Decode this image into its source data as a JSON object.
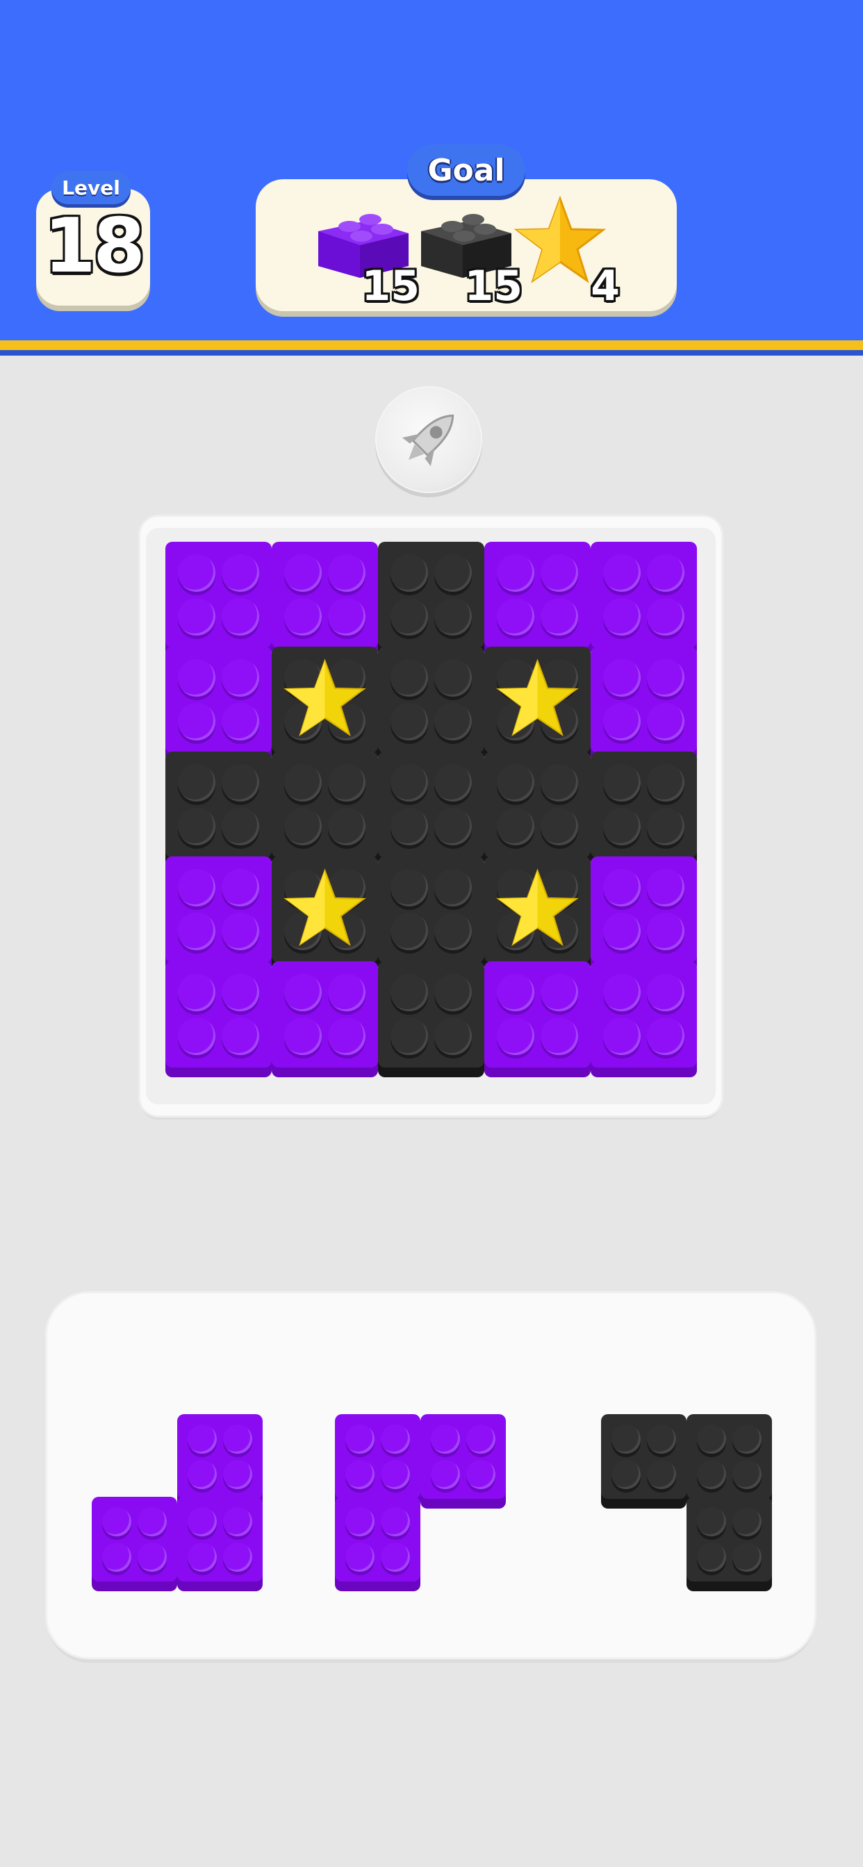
{
  "header": {
    "level_label": "Level",
    "level_number": "18",
    "goal_label": "Goal",
    "goals": [
      {
        "item": "purple-brick-icon",
        "count": "15",
        "color": "#7a12f0"
      },
      {
        "item": "black-brick-icon",
        "count": "15",
        "color": "#2e2e2e"
      },
      {
        "item": "star-icon",
        "count": "4",
        "color": "#f5c01c"
      }
    ]
  },
  "booster": {
    "icon": "rocket-icon"
  },
  "colors": {
    "purple": "#8a0bf2",
    "black": "#2e2e2e",
    "header_blue": "#3d6dfd",
    "accent_yellow": "#f5c01c"
  },
  "board": {
    "rows": 5,
    "cols": 5,
    "cells": [
      [
        "P",
        "P",
        "B",
        "P",
        "P"
      ],
      [
        "P",
        "B*",
        "B",
        "B*",
        "P"
      ],
      [
        "B",
        "B",
        "B",
        "B",
        "B"
      ],
      [
        "P",
        "B*",
        "B",
        "B*",
        "P"
      ],
      [
        "P",
        "P",
        "B",
        "P",
        "P"
      ]
    ],
    "legend": {
      "P": "purple brick",
      "B": "black brick",
      "B*": "black brick with star"
    }
  },
  "tray": {
    "pieces": [
      {
        "color": "purple",
        "shape": [
          [
            0,
            1
          ],
          [
            1,
            1
          ]
        ]
      },
      {
        "color": "purple",
        "shape": [
          [
            1,
            1
          ],
          [
            1,
            0
          ]
        ]
      },
      {
        "color": "black",
        "shape": [
          [
            1,
            1
          ],
          [
            0,
            1
          ]
        ]
      }
    ]
  }
}
